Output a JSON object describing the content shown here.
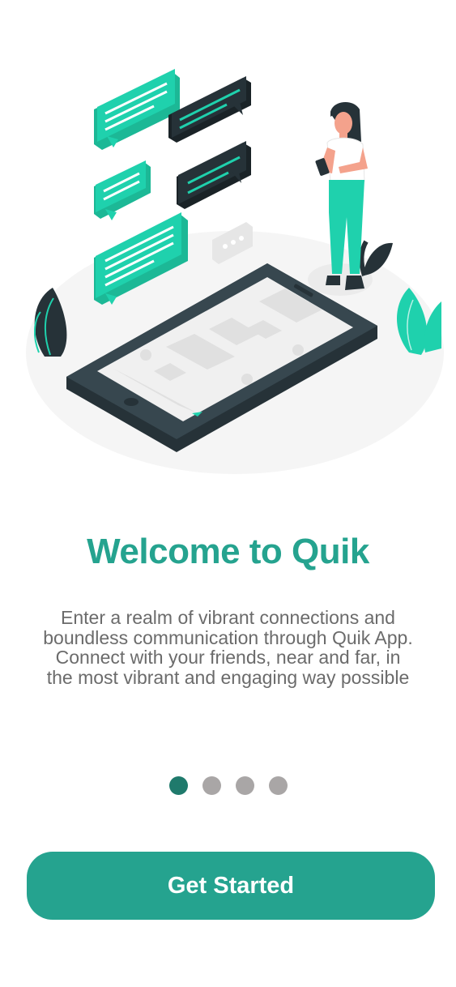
{
  "onboarding": {
    "title": "Welcome to Quik",
    "description": "Enter a realm of vibrant connections and boundless communication through Quik App. Connect with your friends, near and far, in the most vibrant and engaging way possible",
    "pagination": {
      "total": 4,
      "current": 1
    },
    "cta_label": "Get Started"
  },
  "colors": {
    "primary": "#25a38f",
    "dot_active": "#1f7a6c",
    "dot_inactive": "#a9a6a6",
    "text_secondary": "#6b6b6b",
    "accent_teal": "#1fd1ad",
    "dark_slate": "#263238"
  },
  "icons": [
    "chat-bubble-icon",
    "smartphone-icon",
    "leaf-icon",
    "typing-indicator-icon"
  ]
}
